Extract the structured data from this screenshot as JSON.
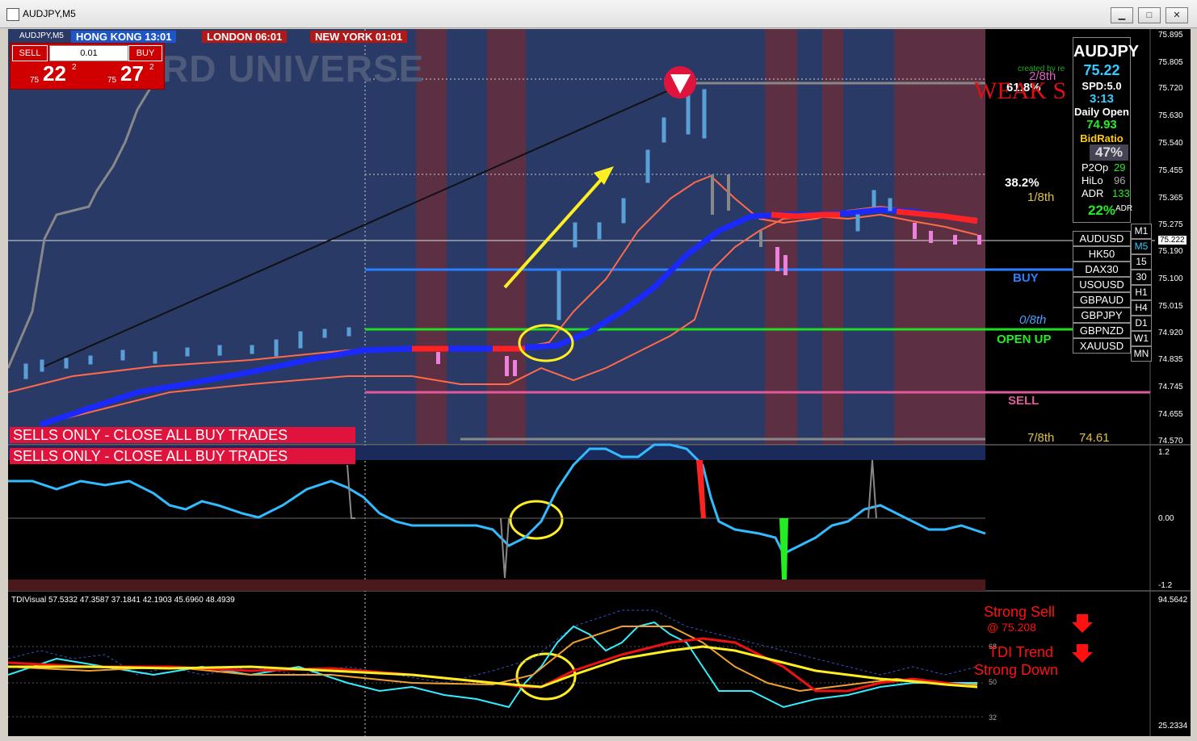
{
  "window": {
    "title": "AUDJPY,M5"
  },
  "sessions": [
    {
      "label": "HONG KONG 13:01",
      "color": "#1e56c8"
    },
    {
      "label": "LONDON 06:01",
      "color": "#b11818"
    },
    {
      "label": "NEW YORK 01:01",
      "color": "#b11818"
    }
  ],
  "trade_panel": {
    "sell_label": "SELL",
    "buy_label": "BUY",
    "lot": "0.01",
    "sell_prefix": "75",
    "sell_big": "22",
    "sell_sup": "2",
    "buy_prefix": "75",
    "buy_big": "27",
    "buy_sup": "2"
  },
  "watermark": "RD UNIVERSE",
  "banners": [
    "SELLS ONLY - CLOSE ALL BUY TRADES",
    "SELLS ONLY - CLOSE ALL BUY TRADES"
  ],
  "info_box": {
    "symbol": "AUDJPY",
    "price": "75.22",
    "spd": "SPD:5.0",
    "timer": "3:13",
    "daily_open_label": "Daily Open",
    "daily_open": "74.93",
    "bid_ratio_label": "BidRatio",
    "bid_ratio": "47%",
    "p2op_label": "P2Op",
    "p2op": "29",
    "hilo_label": "HiLo",
    "hilo": "96",
    "adr_label": "ADR",
    "adr": "133",
    "adr_pct": "22%",
    "adr_small": "ADR"
  },
  "symbols": [
    "AUDUSD",
    "HK50",
    "DAX30",
    "USOUSD",
    "GBPAUD",
    "GBPJPY",
    "GBPNZD",
    "XAUUSD"
  ],
  "timeframes": [
    "M1",
    "M5",
    "15",
    "30",
    "H1",
    "H4",
    "D1",
    "W1",
    "MN"
  ],
  "levels": {
    "l28": "2/8th",
    "l618": "61.8%",
    "l382": "38.2%",
    "l18": "1/8th",
    "buy": "BUY",
    "l08": "0/8th",
    "open_up": "OPEN UP",
    "sell": "SELL",
    "l78": "7/8th",
    "l78v": "74.61",
    "weak": "WEAK S",
    "created": "created by re"
  },
  "price_axis": [
    "75.895",
    "75.805",
    "75.720",
    "75.630",
    "75.540",
    "75.455",
    "75.365",
    "75.275",
    "75.222",
    "75.190",
    "75.100",
    "75.015",
    "74.920",
    "74.835",
    "74.745",
    "74.655",
    "74.570"
  ],
  "osc_axis": [
    "1.2",
    "0.00",
    "-1.2"
  ],
  "tdi": {
    "label": "TDIVisual 57.5332 47.3587 37.1841 42.1903 45.6960 48.4939",
    "axis": [
      "94.5642",
      "68",
      "50",
      "32",
      "25.2334"
    ],
    "strong_sell": "Strong Sell",
    "strong_sell_price": "@ 75.208",
    "tdi_trend": "TDI Trend",
    "strong_down": "Strong Down"
  },
  "colors": {
    "bg": "#000000",
    "blue_zone": "#28355a",
    "red_zone": "#5a2a3a",
    "accent": "#e0133d"
  }
}
